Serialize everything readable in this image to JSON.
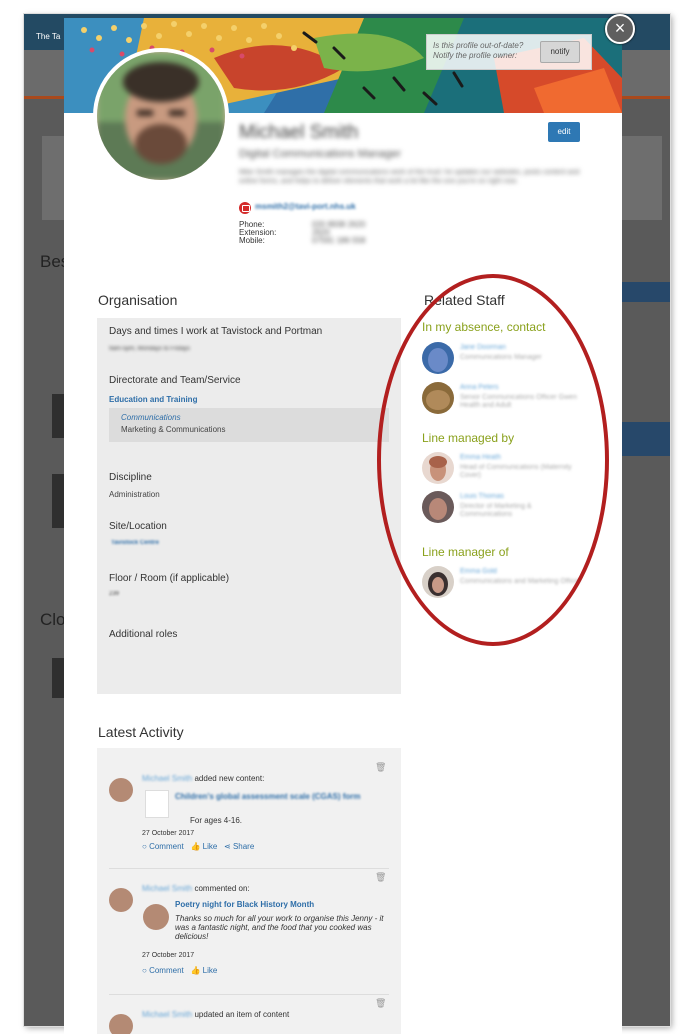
{
  "background": {
    "site_title": "The Ta"
  },
  "banner": {
    "notify_text": "Is this profile out-of-date? Notify the profile owner:",
    "notify_button": "notify"
  },
  "profile": {
    "name": "Michael Smith",
    "job_title": "Digital Communications Manager",
    "bio": "Mike Smith manages the digital communications work of the trust: he updates our websites, posts content and online forms, and helps to deliver elements that work a lot like the one you're on right now.",
    "email": "msmith2@tavi-port.nhs.uk",
    "phone_label": "Phone:",
    "extension_label": "Extension:",
    "mobile_label": "Mobile:",
    "phone": "020 8938 2620",
    "extension": "2620",
    "mobile": "07591 186 558",
    "edit_label": "edit"
  },
  "organisation": {
    "title": "Organisation",
    "days_label": "Days and times I work at Tavistock and Portman",
    "days_value": "9am-5pm, Mondays to Fridays",
    "directorate_label": "Directorate and Team/Service",
    "directorate_value": "Education and Training",
    "team_link": "Communications",
    "team_value": "Marketing & Communications",
    "discipline_label": "Discipline",
    "discipline_value": "Administration",
    "site_label": "Site/Location",
    "site_value": "Tavistock Centre",
    "floor_label": "Floor / Room (if applicable)",
    "floor_value": "239",
    "roles_label": "Additional roles"
  },
  "related": {
    "title": "Related Staff",
    "absence_heading": "In my absence, contact",
    "absence": [
      {
        "name": "Jane Doorman",
        "role": "Communications Manager"
      },
      {
        "name": "Anna Peters",
        "role": "Senior Communications Officer Gwen Health and Adult"
      }
    ],
    "managed_heading": "Line managed by",
    "managed_by": [
      {
        "name": "Emma Heath",
        "role": "Head of Communications (Maternity Cover)"
      },
      {
        "name": "Louis Thomas",
        "role": "Director of Marketing & Communications"
      }
    ],
    "manager_heading": "Line manager of",
    "manager_of": [
      {
        "name": "Emma Gold",
        "role": "Communications and Marketing Officer"
      }
    ]
  },
  "activity": {
    "title": "Latest Activity",
    "items": [
      {
        "user": "Michael Smith",
        "action": "added new content:",
        "target": "Children's global assessment scale (CGAS) form",
        "detail": "For ages 4-16.",
        "date": "27 October 2017",
        "comment": "Comment",
        "like": "Like",
        "share": "Share"
      },
      {
        "user": "Michael Smith",
        "action": "commented on:",
        "target": "Poetry night for Black History Month",
        "detail": "Thanks so much for all your work to organise this Jenny - it was a fantastic night, and the food that you cooked was delicious!",
        "date": "27 October 2017",
        "comment": "Comment",
        "like": "Like"
      },
      {
        "user": "Michael Smith",
        "action": "updated an item of content"
      }
    ]
  },
  "colors": {
    "accent_link": "#2e6ea8",
    "related_heading": "#8aa11c",
    "annotation_ring": "#b21f1f",
    "edit_button": "#2e78b4"
  }
}
